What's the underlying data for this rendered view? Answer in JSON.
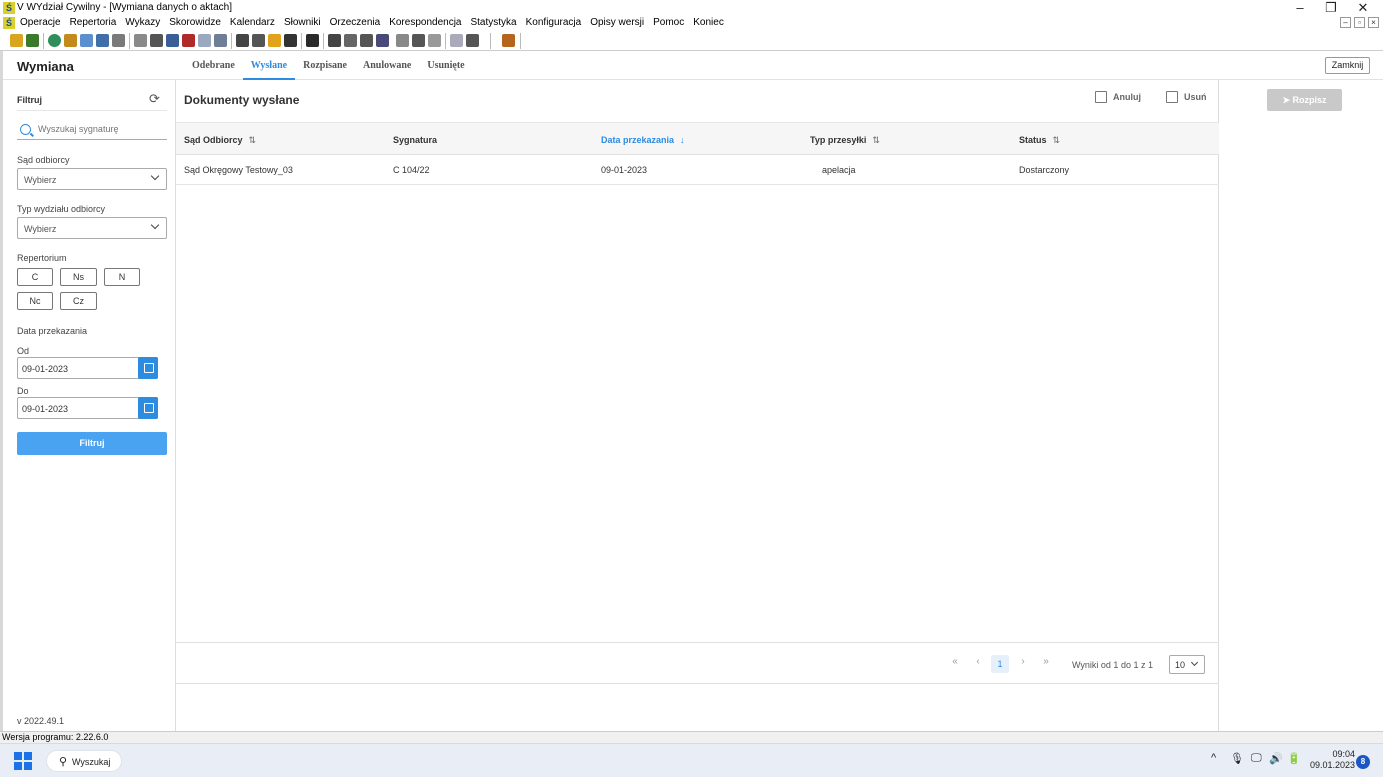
{
  "window": {
    "title": "V WYdział Cywilny - [Wymiana danych o aktach]",
    "app_icon": "Ś",
    "minimize": "–",
    "restore": "❐",
    "close": "✕"
  },
  "menubar": {
    "icon": "Ś",
    "items": [
      "Operacje",
      "Repertoria",
      "Wykazy",
      "Skorowidze",
      "Kalendarz",
      "Słowniki",
      "Orzeczenia",
      "Korespondencja",
      "Statystyka",
      "Konfiguracja",
      "Opisy wersji",
      "Pomoc",
      "Koniec"
    ],
    "mdi": [
      "–",
      "▫",
      "×"
    ]
  },
  "header": {
    "app_title": "Wymiana",
    "tabs": [
      "Odebrane",
      "Wysłane",
      "Rozpisane",
      "Anulowane",
      "Usunięte"
    ],
    "active_tab": "Wysłane",
    "close_label": "Zamknij"
  },
  "sidebar": {
    "filter_title": "Filtruj",
    "refresh_icon": "⟳",
    "search_placeholder": "Wyszukaj sygnaturę",
    "court_label": "Sąd odbiorcy",
    "court_value": "Wybierz",
    "dept_label": "Typ wydziału odbiorcy",
    "dept_value": "Wybierz",
    "repertorium_label": "Repertorium",
    "repertoria": [
      "C",
      "Ns",
      "N",
      "Nc",
      "Cz"
    ],
    "date_label": "Data przekazania",
    "from_label": "Od",
    "from_value": "09-01-2023",
    "to_label": "Do",
    "to_value": "09-01-2023",
    "filter_button": "Filtruj",
    "version": "v 2022.49.1"
  },
  "main": {
    "title": "Dokumenty wysłane",
    "actions": {
      "cancel": "Anuluj",
      "delete": "Usuń",
      "send": "Rozpisz"
    },
    "columns": [
      "Sąd Odbiorcy",
      "Sygnatura",
      "Data przekazania",
      "Typ przesyłki",
      "Status"
    ],
    "sort_icons": [
      "⇅",
      "",
      "↓",
      "⇅",
      "⇅"
    ],
    "sorted_column": "Data przekazania",
    "rows": [
      [
        "Sąd Okręgowy Testowy_03",
        "C 104/22",
        "09-01-2023",
        "apelacja",
        "Dostarczony"
      ]
    ],
    "pagination": {
      "first": "«",
      "prev": "‹",
      "current": "1",
      "next": "›",
      "last": "»",
      "results": "Wyniki od 1 do 1 z 1",
      "page_size": "10"
    }
  },
  "statusbar": {
    "text": "Wersja programu: 2.22.6.0"
  },
  "taskbar": {
    "search_label": "Wyszukaj",
    "time": "09:04",
    "date": "09.01.2023",
    "notifications": "8",
    "tray_icons": [
      "^",
      "🎙",
      "🖵",
      "🔊",
      "🔋"
    ]
  },
  "colors": {
    "accent": "#2d8be0",
    "filter_button": "#4aa3f0",
    "disabled_button": "#c9c9c9"
  }
}
